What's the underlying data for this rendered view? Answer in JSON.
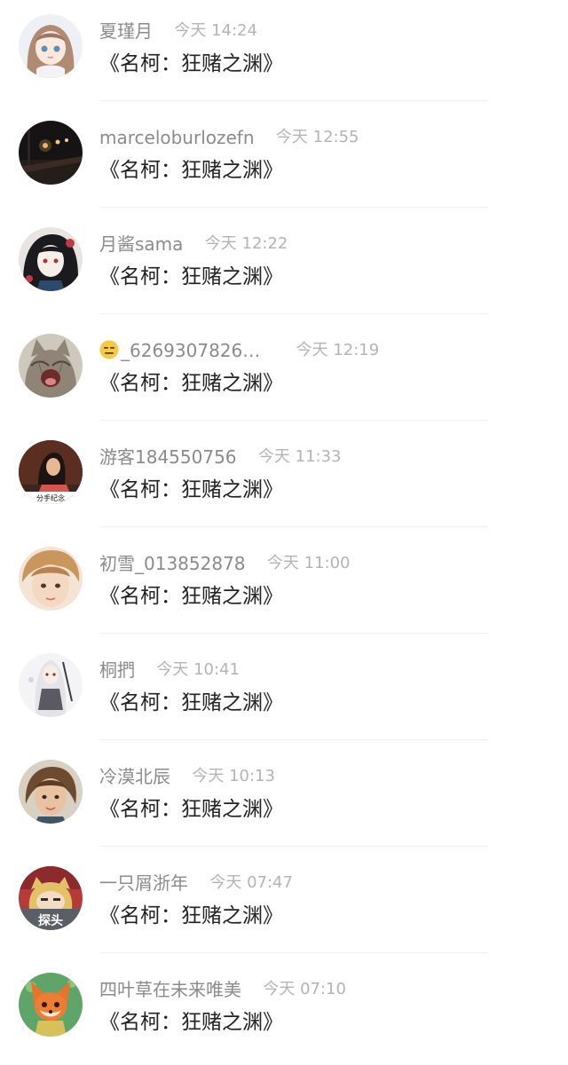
{
  "comments": [
    {
      "name": "夏瑾月",
      "time": "今天 14:24",
      "text": "《名柯：狂赌之渊》",
      "avatar": "anime-girl-brown-hair-avatar"
    },
    {
      "name": "marceloburlozefn",
      "time": "今天 12:55",
      "text": "《名柯：狂赌之渊》",
      "avatar": "night-street-lights-avatar"
    },
    {
      "name": "月酱sama",
      "time": "今天 12:22",
      "text": "《名柯：狂赌之渊》",
      "avatar": "manga-girl-black-hair-avatar"
    },
    {
      "name": "_6269307826…",
      "time": "今天 12:19",
      "text": "《名柯：狂赌之渊》",
      "avatar": "screaming-cat-avatar",
      "name_prefix_icon": "neutral-face-emoji"
    },
    {
      "name": "游客184550756",
      "time": "今天 11:33",
      "text": "《名柯：狂赌之渊》",
      "avatar": "breakup-memorial-photo-avatar",
      "avatar_caption": "分手纪念"
    },
    {
      "name": "初雪_013852878",
      "time": "今天 11:00",
      "text": "《名柯：狂赌之渊》",
      "avatar": "blonde-boy-face-avatar"
    },
    {
      "name": "桐捫",
      "time": "今天 10:41",
      "text": "《名柯：狂赌之渊》",
      "avatar": "white-hair-anime-girl-avatar"
    },
    {
      "name": "冷漠北辰",
      "time": "今天 10:13",
      "text": "《名柯：狂赌之渊》",
      "avatar": "illustrated-boy-avatar"
    },
    {
      "name": "一只屑浙年",
      "time": "今天 07:47",
      "text": "《名柯：狂赌之渊》",
      "avatar": "anime-character-peeking-avatar",
      "avatar_caption": "探头"
    },
    {
      "name": "四叶草在未来唯美",
      "time": "今天 07:10",
      "text": "《名柯：狂赌之渊》",
      "avatar": "cartoon-fox-avatar"
    }
  ]
}
